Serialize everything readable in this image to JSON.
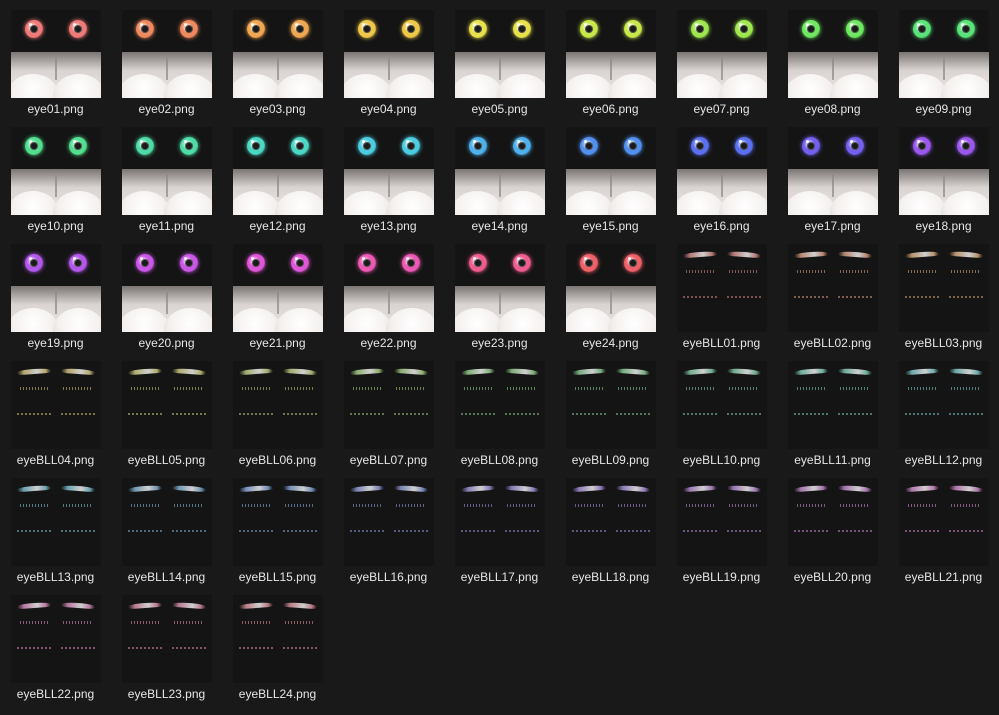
{
  "files": [
    {
      "name": "eye01.png",
      "kind": "eye",
      "color": "#f07a78"
    },
    {
      "name": "eye02.png",
      "kind": "eye",
      "color": "#f08a5e"
    },
    {
      "name": "eye03.png",
      "kind": "eye",
      "color": "#f0a64e"
    },
    {
      "name": "eye04.png",
      "kind": "eye",
      "color": "#f0c848"
    },
    {
      "name": "eye05.png",
      "kind": "eye",
      "color": "#e8e24a"
    },
    {
      "name": "eye06.png",
      "kind": "eye",
      "color": "#c8e84a"
    },
    {
      "name": "eye07.png",
      "kind": "eye",
      "color": "#9ee84e"
    },
    {
      "name": "eye08.png",
      "kind": "eye",
      "color": "#6ee860"
    },
    {
      "name": "eye09.png",
      "kind": "eye",
      "color": "#58e478"
    },
    {
      "name": "eye10.png",
      "kind": "eye",
      "color": "#52e08e"
    },
    {
      "name": "eye11.png",
      "kind": "eye",
      "color": "#4edca6"
    },
    {
      "name": "eye12.png",
      "kind": "eye",
      "color": "#4ad8c4"
    },
    {
      "name": "eye13.png",
      "kind": "eye",
      "color": "#4ccce0"
    },
    {
      "name": "eye14.png",
      "kind": "eye",
      "color": "#4eb0ec"
    },
    {
      "name": "eye15.png",
      "kind": "eye",
      "color": "#5290f0"
    },
    {
      "name": "eye16.png",
      "kind": "eye",
      "color": "#5a70f0"
    },
    {
      "name": "eye17.png",
      "kind": "eye",
      "color": "#7460f0"
    },
    {
      "name": "eye18.png",
      "kind": "eye",
      "color": "#9a58ee"
    },
    {
      "name": "eye19.png",
      "kind": "eye",
      "color": "#b458ec"
    },
    {
      "name": "eye20.png",
      "kind": "eye",
      "color": "#cc56e8"
    },
    {
      "name": "eye21.png",
      "kind": "eye",
      "color": "#e056d8"
    },
    {
      "name": "eye22.png",
      "kind": "eye",
      "color": "#ec58b4"
    },
    {
      "name": "eye23.png",
      "kind": "eye",
      "color": "#f05c90"
    },
    {
      "name": "eye24.png",
      "kind": "eye",
      "color": "#f06068"
    },
    {
      "name": "eyeBLL01.png",
      "kind": "brow",
      "color": "#d08a86"
    },
    {
      "name": "eyeBLL02.png",
      "kind": "brow",
      "color": "#d49a80"
    },
    {
      "name": "eyeBLL03.png",
      "kind": "brow",
      "color": "#d4aa7c"
    },
    {
      "name": "eyeBLL04.png",
      "kind": "brow",
      "color": "#d0c07c"
    },
    {
      "name": "eyeBLL05.png",
      "kind": "brow",
      "color": "#c8c87c"
    },
    {
      "name": "eyeBLL06.png",
      "kind": "brow",
      "color": "#b8c87c"
    },
    {
      "name": "eyeBLL07.png",
      "kind": "brow",
      "color": "#a4c880"
    },
    {
      "name": "eyeBLL08.png",
      "kind": "brow",
      "color": "#90c888"
    },
    {
      "name": "eyeBLL09.png",
      "kind": "brow",
      "color": "#86c894"
    },
    {
      "name": "eyeBLL10.png",
      "kind": "brow",
      "color": "#80c8a4"
    },
    {
      "name": "eyeBLL11.png",
      "kind": "brow",
      "color": "#7cc8b4"
    },
    {
      "name": "eyeBLL12.png",
      "kind": "brow",
      "color": "#7cc4c4"
    },
    {
      "name": "eyeBLL13.png",
      "kind": "brow",
      "color": "#7cbccc"
    },
    {
      "name": "eyeBLL14.png",
      "kind": "brow",
      "color": "#80b0d0"
    },
    {
      "name": "eyeBLL15.png",
      "kind": "brow",
      "color": "#84a4d4"
    },
    {
      "name": "eyeBLL16.png",
      "kind": "brow",
      "color": "#8c98d4"
    },
    {
      "name": "eyeBLL17.png",
      "kind": "brow",
      "color": "#9890d4"
    },
    {
      "name": "eyeBLL18.png",
      "kind": "brow",
      "color": "#a48cd4"
    },
    {
      "name": "eyeBLL19.png",
      "kind": "brow",
      "color": "#b48ad0"
    },
    {
      "name": "eyeBLL20.png",
      "kind": "brow",
      "color": "#c088cc"
    },
    {
      "name": "eyeBLL21.png",
      "kind": "brow",
      "color": "#cc88c4"
    },
    {
      "name": "eyeBLL22.png",
      "kind": "brow",
      "color": "#d488b8"
    },
    {
      "name": "eyeBLL23.png",
      "kind": "brow",
      "color": "#d88aa8"
    },
    {
      "name": "eyeBLL24.png",
      "kind": "brow",
      "color": "#d88c98"
    }
  ]
}
